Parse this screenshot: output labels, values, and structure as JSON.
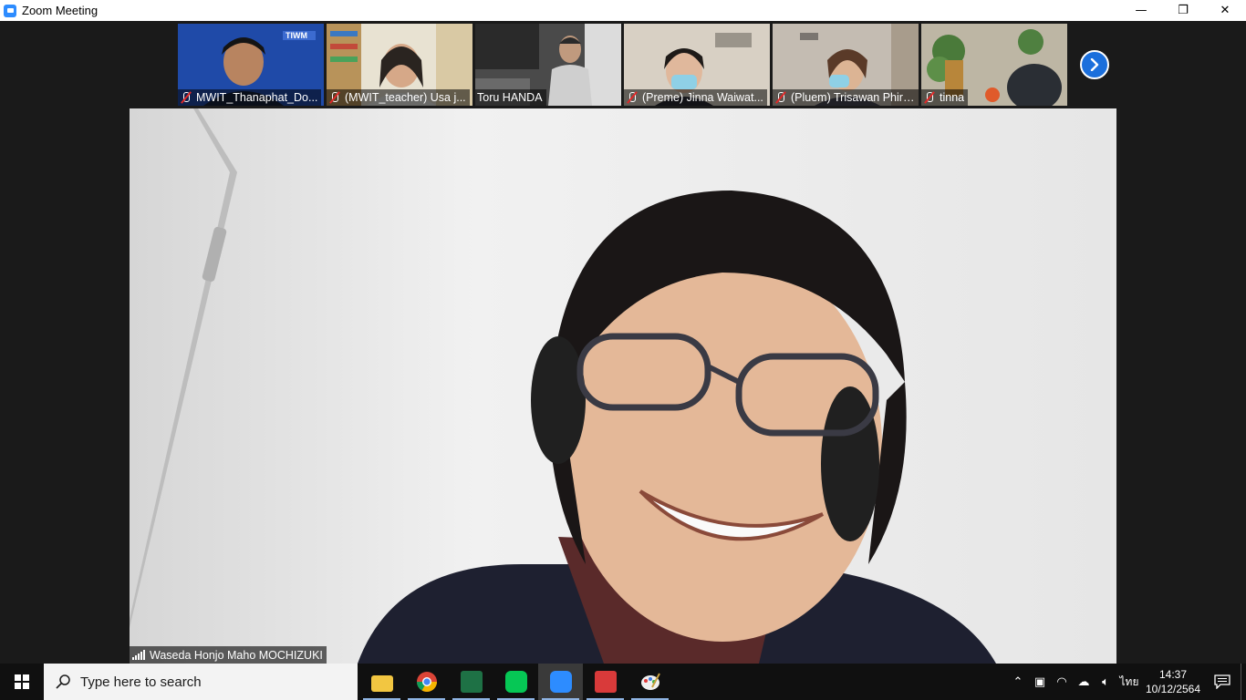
{
  "window": {
    "title": "Zoom Meeting",
    "controls": {
      "minimize": "—",
      "restore": "❐",
      "close": "✕"
    }
  },
  "participants": [
    {
      "name": "MWIT_Thanaphat_Do...",
      "muted": true,
      "bg": "#1f4aa8"
    },
    {
      "name": "(MWIT_teacher) Usa j...",
      "muted": true,
      "bg": "#c9b48e"
    },
    {
      "name": "Toru HANDA",
      "muted": false,
      "bg": "#6c6c6c"
    },
    {
      "name": "(Preme) Jinna Waiwat...",
      "muted": true,
      "bg": "#d8d0c4"
    },
    {
      "name": "(Pluem) Trisawan Phiri...",
      "muted": true,
      "bg": "#c4bcb2"
    },
    {
      "name": "tinna",
      "muted": true,
      "bg": "#8e8a78"
    }
  ],
  "active_speaker": {
    "name": "Waseda Honjo Maho MOCHIZUKI"
  },
  "taskbar": {
    "search_placeholder": "Type here to search",
    "apps": [
      {
        "name": "file-explorer",
        "color": "#f2c641"
      },
      {
        "name": "chrome",
        "color": "#db4437"
      },
      {
        "name": "excel",
        "color": "#1e7145"
      },
      {
        "name": "line",
        "color": "#06c755"
      },
      {
        "name": "zoom",
        "color": "#2d8cff"
      },
      {
        "name": "screen-recorder",
        "color": "#d93a3a"
      },
      {
        "name": "paint",
        "color": "#f0f0f0"
      }
    ],
    "language": "ไทย",
    "time": "14:37",
    "date": "10/12/2564"
  },
  "colors": {
    "zoom_blue": "#2d8cff",
    "next_button": "#1b6fdc",
    "muted_red": "#e02828"
  }
}
